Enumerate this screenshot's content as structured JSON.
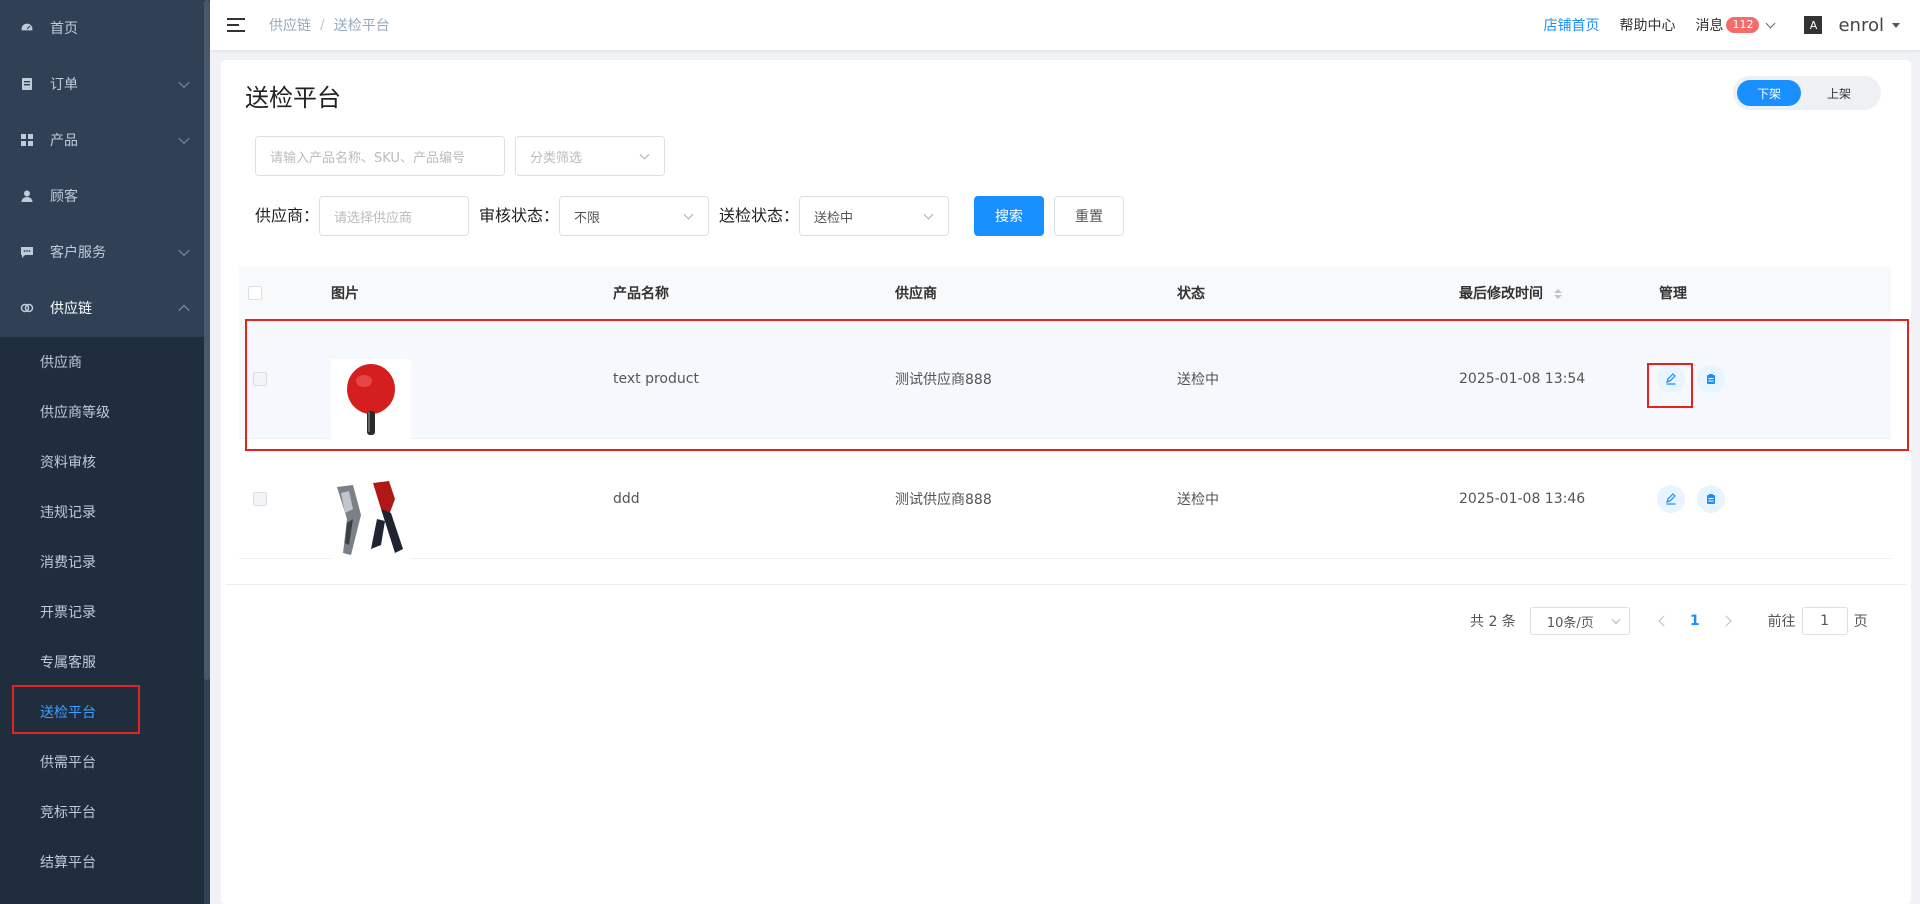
{
  "sidebar": {
    "items": [
      {
        "label": "首页",
        "icon": "dashboard-icon"
      },
      {
        "label": "订单",
        "icon": "order-icon"
      },
      {
        "label": "产品",
        "icon": "grid-icon"
      },
      {
        "label": "顾客",
        "icon": "user-icon"
      },
      {
        "label": "客户服务",
        "icon": "chat-icon"
      },
      {
        "label": "供应链",
        "icon": "link-icon"
      }
    ],
    "submenu": [
      {
        "label": "供应商"
      },
      {
        "label": "供应商等级"
      },
      {
        "label": "资料审核"
      },
      {
        "label": "违规记录"
      },
      {
        "label": "消费记录"
      },
      {
        "label": "开票记录"
      },
      {
        "label": "专属客服"
      },
      {
        "label": "送检平台"
      },
      {
        "label": "供需平台"
      },
      {
        "label": "竞标平台"
      },
      {
        "label": "结算平台"
      }
    ]
  },
  "header": {
    "breadcrumb": [
      "供应链",
      "送检平台"
    ],
    "store_home": "店铺首页",
    "help": "帮助中心",
    "messages": "消息",
    "message_count": "112",
    "lang_icon": "A",
    "user": "enrol"
  },
  "main": {
    "title": "送检平台",
    "toggle": [
      "下架",
      "上架"
    ],
    "search_placeholder": "请输入产品名称、SKU、产品编号",
    "category_placeholder": "分类筛选",
    "supplier_label": "供应商：",
    "supplier_placeholder": "请选择供应商",
    "audit_label": "审核状态：",
    "audit_value": "不限",
    "inspect_label": "送检状态：",
    "inspect_value": "送检中",
    "search_btn": "搜索",
    "reset_btn": "重置"
  },
  "table": {
    "headers": [
      "图片",
      "产品名称",
      "供应商",
      "状态",
      "最后修改时间",
      "管理"
    ],
    "rows": [
      {
        "name": "text product",
        "supplier": "测试供应商888",
        "status": "送检中",
        "time": "2025-01-08 13:54",
        "image": "paddle"
      },
      {
        "name": "ddd",
        "supplier": "测试供应商888",
        "status": "送检中",
        "time": "2025-01-08 13:46",
        "image": "pants"
      }
    ]
  },
  "pagination": {
    "total": "共 2 条",
    "page_size": "10条/页",
    "current": "1",
    "goto_label": "前往",
    "goto_value": "1",
    "page_suffix": "页"
  },
  "colors": {
    "primary": "#1890ff",
    "sidebar": "#304156",
    "highlight": "#e32222"
  }
}
